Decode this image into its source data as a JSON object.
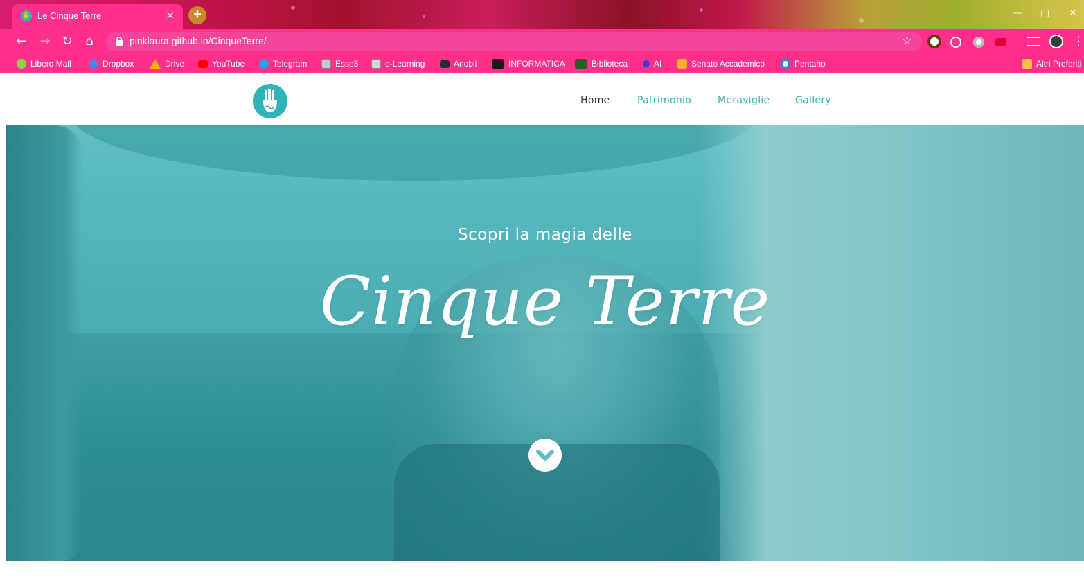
{
  "browser": {
    "tab": {
      "title": "Le Cinque Terre",
      "close": "×"
    },
    "new_tab": "+",
    "address": {
      "url": "pinklaura.github.io/CinqueTerre/"
    },
    "bookmarks": [
      {
        "label": "Libero Mail",
        "icon": "libero-icon",
        "color": "#8ed24a"
      },
      {
        "label": "Dropbox",
        "icon": "dropbox-icon",
        "color": "#3d8af7"
      },
      {
        "label": "Drive",
        "icon": "drive-icon",
        "color": "#f4b400"
      },
      {
        "label": "YouTube",
        "icon": "youtube-icon",
        "color": "#ff0000"
      },
      {
        "label": "Telegram",
        "icon": "telegram-icon",
        "color": "#2aa3df"
      },
      {
        "label": "Esse3",
        "icon": "esse3-icon",
        "color": "#c9c9c9"
      },
      {
        "label": "e-Learning",
        "icon": "elearning-icon",
        "color": "#d6d6d6"
      },
      {
        "label": "Anobii",
        "icon": "anobii-icon",
        "color": "#2b2b2b"
      },
      {
        "label": "INFORMATICA",
        "icon": "informatica-icon",
        "color": "#1a1a1a"
      },
      {
        "label": "Biblioteca",
        "icon": "biblioteca-icon",
        "color": "#2b5a2b"
      },
      {
        "label": "AI",
        "icon": "ai-icon",
        "color": "#3b3bd6"
      },
      {
        "label": "Senato Accademico",
        "icon": "senato-icon",
        "color": "#f2b32a"
      },
      {
        "label": "Pentaho",
        "icon": "pentaho-icon",
        "color": "#1a8fd6"
      }
    ],
    "other_bookmarks": "Altri Preferiti"
  },
  "site": {
    "nav": [
      {
        "label": "Home",
        "active": true
      },
      {
        "label": "Patrimonio",
        "active": false
      },
      {
        "label": "Meraviglie",
        "active": false
      },
      {
        "label": "Gallery",
        "active": false
      }
    ],
    "hero": {
      "subtitle": "Scopri la magia delle",
      "title": "Cinque Terre"
    }
  },
  "colors": {
    "chrome_pink": "#ff2f8b",
    "accent_teal": "#2fb5b8"
  }
}
